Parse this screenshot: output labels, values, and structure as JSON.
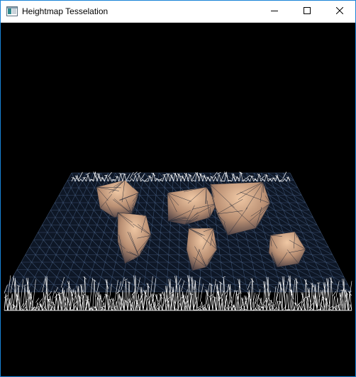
{
  "window": {
    "title": "Heightmap Tesselation",
    "border_color": "#1883d7",
    "icons": {
      "app": "app-window-icon",
      "minimize": "minimize-icon",
      "maximize": "maximize-icon",
      "close": "close-icon"
    }
  },
  "viewport": {
    "background": "#000000",
    "content": "wireframe-heightmap-terrain",
    "colors": {
      "sea_mesh": "#3a4f6e",
      "land": "#b98f73",
      "land_highlight": "#f0c8a4",
      "edge_mesh": "#ffffff"
    }
  }
}
